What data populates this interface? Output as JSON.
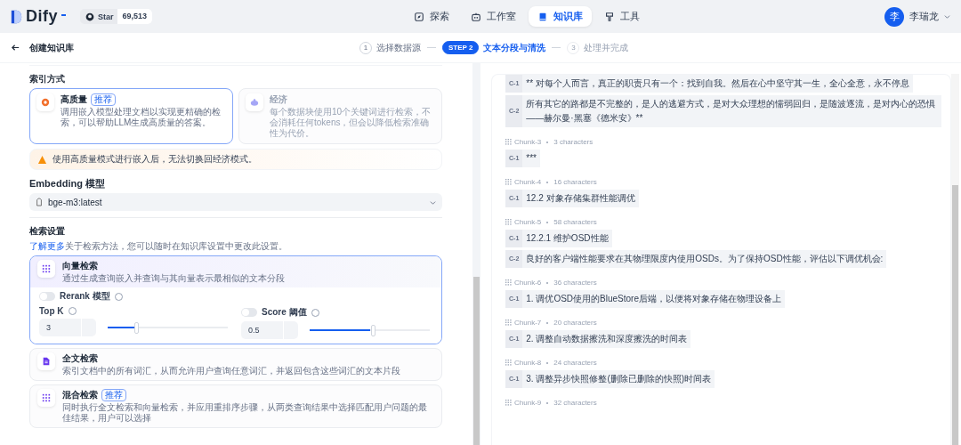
{
  "nav": {
    "logo": "Dify",
    "github": {
      "label": "Star",
      "count": "69,513"
    },
    "items": [
      {
        "label": "探索",
        "selected": false
      },
      {
        "label": "工作室",
        "selected": false
      },
      {
        "label": "知识库",
        "selected": true
      },
      {
        "label": "工具",
        "selected": false
      }
    ],
    "user": {
      "avatar": "李",
      "name": "李瑞龙"
    }
  },
  "header": {
    "back": "创建知识库",
    "steps": [
      {
        "badge": "1",
        "label": "选择数据源",
        "kind": "done"
      },
      {
        "badge": "STEP 2",
        "label": "文本分段与清洗",
        "kind": "active"
      },
      {
        "badge": "3",
        "label": "处理并完成",
        "kind": "pending"
      }
    ]
  },
  "index": {
    "title": "索引方式",
    "options": [
      {
        "title": "高质量",
        "tag": "推荐",
        "description": "调用嵌入模型处理文档以实现更精确的检索，可以帮助LLM生成高质量的答案。",
        "selected": true
      },
      {
        "title": "经济",
        "description": "每个数据块使用10个关键词进行检索，不会消耗任何tokens，但会以降低检索准确性为代价。",
        "selected": false
      }
    ],
    "warning": "使用高质量模式进行嵌入后，无法切换回经济模式。"
  },
  "embedding": {
    "label": "Embedding 模型",
    "value": "bge-m3:latest"
  },
  "retrieval": {
    "title": "检索设置",
    "link": "了解更多",
    "note": "关于检索方法，您可以随时在知识库设置中更改此设置。",
    "methods": [
      {
        "title": "向量检索",
        "description": "通过生成查询嵌入并查询与其向量表示最相似的文本分段",
        "selected": true,
        "rerank": {
          "label": "Rerank 模型",
          "on": false
        },
        "top_k": {
          "label": "Top K",
          "value": "3",
          "level": 0.23
        },
        "score": {
          "label": "Score 阈值",
          "on": false,
          "value": "0.5",
          "level": 0.5
        }
      },
      {
        "title": "全文检索",
        "description": "索引文档中的所有词汇，从而允许用户查询任意词汇，并返回包含这些词汇的文本片段",
        "selected": false
      },
      {
        "title": "混合检索",
        "tag": "推荐",
        "description": "同时执行全文检索和向量检索，并应用重排序步骤，从两类查询结果中选择匹配用户问题的最佳结果，用户可以选择",
        "selected": false
      }
    ]
  },
  "chunks": [
    {
      "segments": [
        {
          "tag": "C-1",
          "text": "** 对每个人而言，真正的职责只有一个：找到自我。然后在心中坚守其一生，全心全意，永不停息"
        },
        {
          "tag": "C-2",
          "text": "所有其它的路都是不完整的，是人的逃避方式，是对大众理想的懦弱回归，是随波逐流，是对内心的恐惧 ——赫尔曼·黑塞《德米安》**"
        }
      ]
    },
    {
      "name": "Chunk-3",
      "count": "3 characters",
      "segments": [
        {
          "tag": "C-1",
          "text": "***"
        }
      ]
    },
    {
      "name": "Chunk-4",
      "count": "16 characters",
      "segments": [
        {
          "tag": "C-1",
          "text": "12.2 对象存储集群性能调优"
        }
      ]
    },
    {
      "name": "Chunk-5",
      "count": "58 characters",
      "segments": [
        {
          "tag": "C-1",
          "text": "12.2.1 维护OSD性能"
        },
        {
          "tag": "C-2",
          "text": "良好的客户端性能要求在其物理限度内使用OSDs。为了保持OSD性能，评估以下调优机会:"
        }
      ]
    },
    {
      "name": "Chunk-6",
      "count": "36 characters",
      "segments": [
        {
          "tag": "C-1",
          "text": "1. 调优OSD使用的BlueStore后端，以便将对象存储在物理设备上"
        }
      ]
    },
    {
      "name": "Chunk-7",
      "count": "20 characters",
      "segments": [
        {
          "tag": "C-1",
          "text": "2. 调整自动数据擦洗和深度擦洗的时间表"
        }
      ]
    },
    {
      "name": "Chunk-8",
      "count": "24 characters",
      "segments": [
        {
          "tag": "C-1",
          "text": "3. 调整异步快照修整(删除已删除的快照)时间表"
        }
      ]
    },
    {
      "name": "Chunk-9",
      "count": "32 characters"
    }
  ]
}
